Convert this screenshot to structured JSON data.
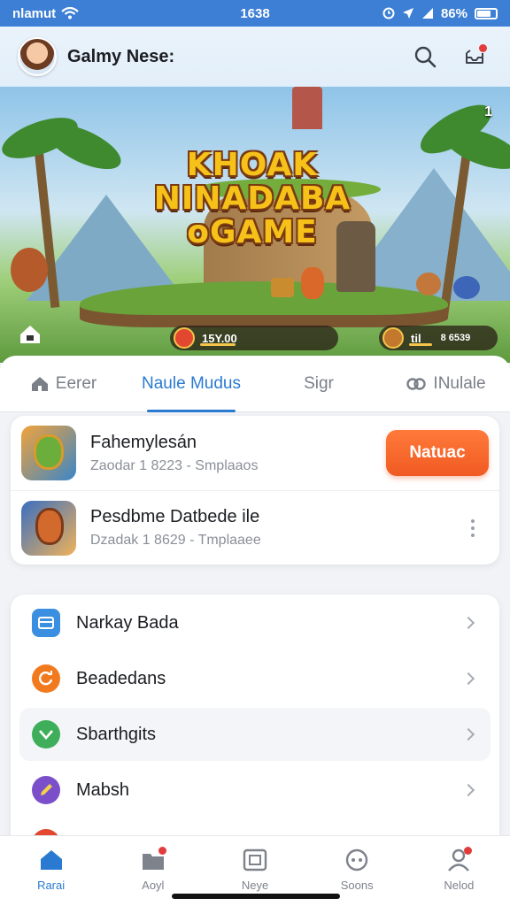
{
  "status_bar": {
    "carrier": "nlamut",
    "time": "1638",
    "battery": "86%"
  },
  "header": {
    "user_name": "Galmy Nese:"
  },
  "hero": {
    "title_lines": [
      "KHOAK",
      "NINADABA",
      "oGAME"
    ],
    "corner_tag": "1",
    "hud_left": "15Y.00",
    "hud_right_a": "til",
    "hud_right_b": "8 6539"
  },
  "tabs": [
    {
      "label": "Eerer",
      "icon": "house-icon",
      "active": false
    },
    {
      "label": "Naule Mudus",
      "icon": "",
      "active": true
    },
    {
      "label": "Sigr",
      "icon": "",
      "active": false
    },
    {
      "label": "INulale",
      "icon": "link-icon",
      "active": false
    }
  ],
  "games": [
    {
      "title": "Fahemylesán",
      "subtitle": "Zaodar 1 8223 - Smplaaos",
      "action": "Natuac"
    },
    {
      "title": "Pesdbme Datbede ile",
      "subtitle": "Dzadak 1 8629 - Tmplaaee",
      "action": ""
    }
  ],
  "menu": [
    {
      "label": "Narkay Bada",
      "icon": "card-icon",
      "color": "#3b8fe0"
    },
    {
      "label": "Beadedans",
      "icon": "refresh-icon",
      "color": "#f27a1e"
    },
    {
      "label": "Sbarthgits",
      "icon": "check-icon",
      "color": "#3fae5a"
    },
    {
      "label": "Mabsh",
      "icon": "pencil-icon",
      "color": "#7a4fc9"
    }
  ],
  "bottom_nav": [
    {
      "label": "Rarai",
      "icon": "home-icon",
      "active": true
    },
    {
      "label": "Aoyl",
      "icon": "folder-icon",
      "active": false
    },
    {
      "label": "Neye",
      "icon": "image-icon",
      "active": false
    },
    {
      "label": "Soons",
      "icon": "gamepad-icon",
      "active": false
    },
    {
      "label": "Nelod",
      "icon": "profile-icon",
      "active": false
    }
  ],
  "colors": {
    "accent": "#2a7ad1",
    "status_bar": "#3d7fd4",
    "action": "#f05a22"
  }
}
